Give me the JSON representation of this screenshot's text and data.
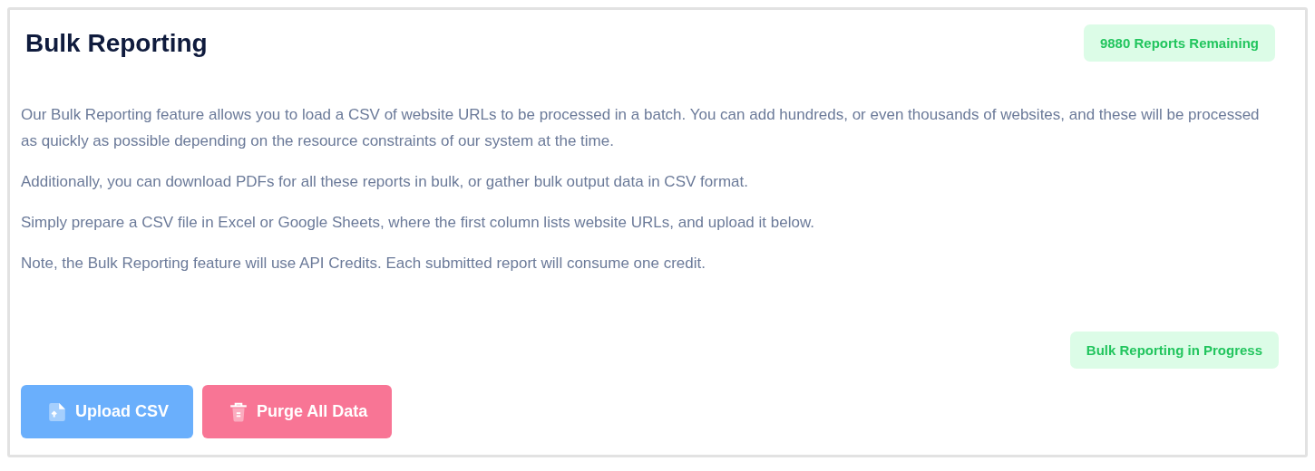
{
  "title": "Bulk Reporting",
  "remaining_badge": "9880 Reports Remaining",
  "paragraphs": [
    "Our Bulk Reporting feature allows you to load a CSV of website URLs to be processed in a batch. You can add hundreds, or even thousands of websites, and these will be processed as quickly as possible depending on the resource constraints of our system at the time.",
    "Additionally, you can download PDFs for all these reports in bulk, or gather bulk output data in CSV format.",
    "Simply prepare a CSV file in Excel or Google Sheets, where the first column lists website URLs, and upload it below.",
    "Note, the Bulk Reporting feature will use API Credits. Each submitted report will consume one credit."
  ],
  "status_badge": "Bulk Reporting in Progress",
  "buttons": [
    {
      "label": "Upload CSV",
      "kind": "upload"
    },
    {
      "label": "Purge All Data",
      "kind": "purge"
    }
  ]
}
